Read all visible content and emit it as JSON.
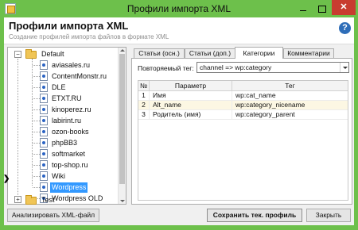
{
  "window": {
    "title": "Профили импорта XML",
    "close_glyph": "✕"
  },
  "header": {
    "title": "Профили импорта XML",
    "subtitle": "Создание профилей импорта файлов в формате XML",
    "help_glyph": "?"
  },
  "tree": {
    "default_folder": "Default",
    "items": [
      "aviasales.ru",
      "ContentMonstr.ru",
      "DLE",
      "ETXT.RU",
      "kinoperez.ru",
      "labirint.ru",
      "ozon-books",
      "phpBB3",
      "softmarket",
      "top-shop.ru",
      "Wiki",
      "Wordpress",
      "Wordpress OLD"
    ],
    "selected": "Wordpress",
    "test_folder": "Test",
    "pointer_glyph": "❯"
  },
  "tabs": [
    {
      "label": "Статьи (осн.)"
    },
    {
      "label": "Статьи (доп.)"
    },
    {
      "label": "Категории"
    },
    {
      "label": "Комментарии"
    }
  ],
  "active_tab": "Категории",
  "categories": {
    "repeat_label": "Повторяемый тег:",
    "repeat_value": "channel => wp:category",
    "columns": [
      "№",
      "Параметр",
      "Тег"
    ],
    "rows": [
      {
        "num": "1",
        "param": "Имя",
        "tag": "wp:cat_name"
      },
      {
        "num": "2",
        "param": "Alt_name",
        "tag": "wp:category_nicename"
      },
      {
        "num": "3",
        "param": "Родитель (имя)",
        "tag": "wp:category_parent"
      }
    ]
  },
  "footer": {
    "analyze_button": "Анализировать XML-файл",
    "save_button": "Сохранить тек. профиль",
    "close_button": "Закрыть"
  }
}
